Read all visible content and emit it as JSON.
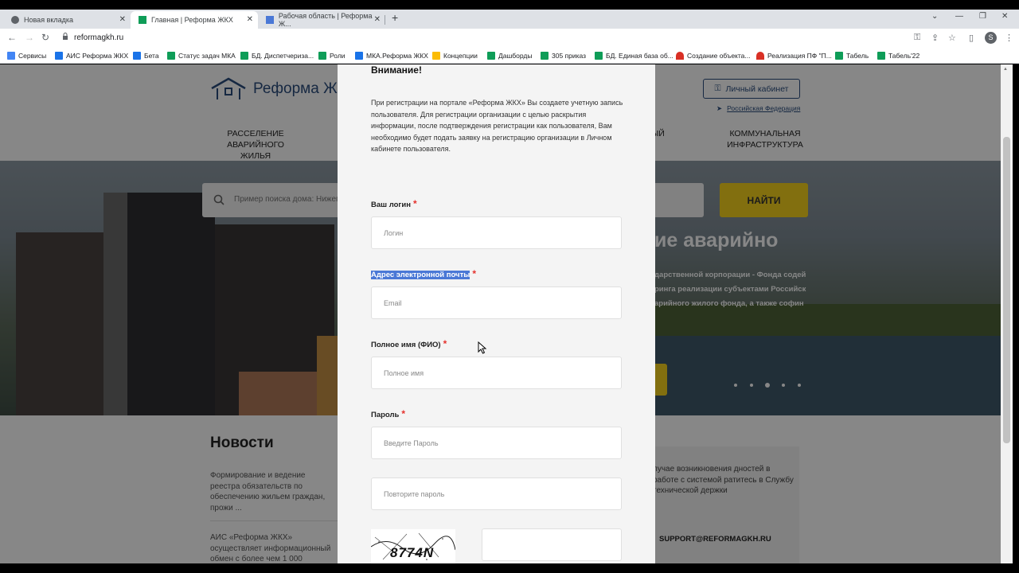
{
  "browser": {
    "tabs": [
      {
        "label": "Новая вкладка",
        "icon": "chrome-icon"
      },
      {
        "label": "Главная | Реформа ЖКХ",
        "icon": "sheets-icon",
        "active": true
      },
      {
        "label": "Рабочая область | Реформа Ж...",
        "icon": "grid-icon"
      }
    ],
    "url": "reformagkh.ru",
    "avatar_letter": "S",
    "bookmarks": [
      {
        "label": "Сервисы",
        "color": "#4285f4"
      },
      {
        "label": "АИС Реформа ЖКХ",
        "color": "#1a73e8"
      },
      {
        "label": "Бета",
        "color": "#1a73e8"
      },
      {
        "label": "Статус задач МКА",
        "color": "#0f9d58"
      },
      {
        "label": "БД. Диспетчериза...",
        "color": "#0f9d58"
      },
      {
        "label": "Роли",
        "color": "#0f9d58"
      },
      {
        "label": "МКА.Реформа ЖКХ",
        "color": "#1a73e8"
      },
      {
        "label": "Концепции",
        "color": "#fbbc04"
      },
      {
        "label": "Дашборды",
        "color": "#0f9d58"
      },
      {
        "label": "305 приказ",
        "color": "#0f9d58"
      },
      {
        "label": "БД. Единая база об...",
        "color": "#0f9d58"
      },
      {
        "label": "Создание объекта...",
        "color": "#d93025"
      },
      {
        "label": "Реализация ПФ \"П...",
        "color": "#d93025"
      },
      {
        "label": "Табель",
        "color": "#0f9d58"
      },
      {
        "label": "Табель'22",
        "color": "#0f9d58"
      }
    ]
  },
  "site": {
    "logo_text": "Реформа ЖКХ",
    "nav": [
      {
        "label": "Расселение аварийного жилья"
      },
      {
        "label": "ЫЙ"
      },
      {
        "label": "Коммунальная инфраструктура"
      }
    ],
    "cabinet_label": "Личный кабинет",
    "region_label": "Российская Федерация",
    "search_placeholder": "Пример поиска дома: Нижег",
    "find_label": "НАЙТИ",
    "hero_title": "ие аварийно",
    "hero_lines": [
      "дарственной корпорации - Фонда содей",
      "ринга реализации субъектами Российск",
      "арийного жилого фонда, а также софин"
    ],
    "news_title": "Новости",
    "news": [
      "Формирование и ведение реестра обязательств по обеспечению жильем граждан, прожи ...",
      "АИС «Реформа ЖКХ» осуществляет информационный обмен с более чем 1 000"
    ],
    "support_text": "лучае возникновения дностей в работе с системой ратитесь в Службу технической держки",
    "support_email": "SUPPORT@REFORMAGKH.RU"
  },
  "modal": {
    "title": "Внимание!",
    "note": "При регистрации на портале «Реформа ЖКХ» Вы создаете учетную запись пользователя. Для регистрации организации с целью раскрытия информации, после подтверждения регистрации как пользователя, Вам необходимо будет подать заявку на регистрацию организации в Личном кабинете пользователя.",
    "fields": {
      "login": {
        "label": "Ваш логин",
        "placeholder": "Логин"
      },
      "email": {
        "label": "Адрес электронной почты",
        "placeholder": "Email"
      },
      "fullname": {
        "label": "Полное имя (ФИО)",
        "placeholder": "Полное имя"
      },
      "password": {
        "label": "Пароль",
        "placeholder": "Введите Пароль"
      },
      "password2": {
        "placeholder": "Повторите пароль"
      }
    },
    "required_mark": "*",
    "captcha_text": "8774N"
  }
}
